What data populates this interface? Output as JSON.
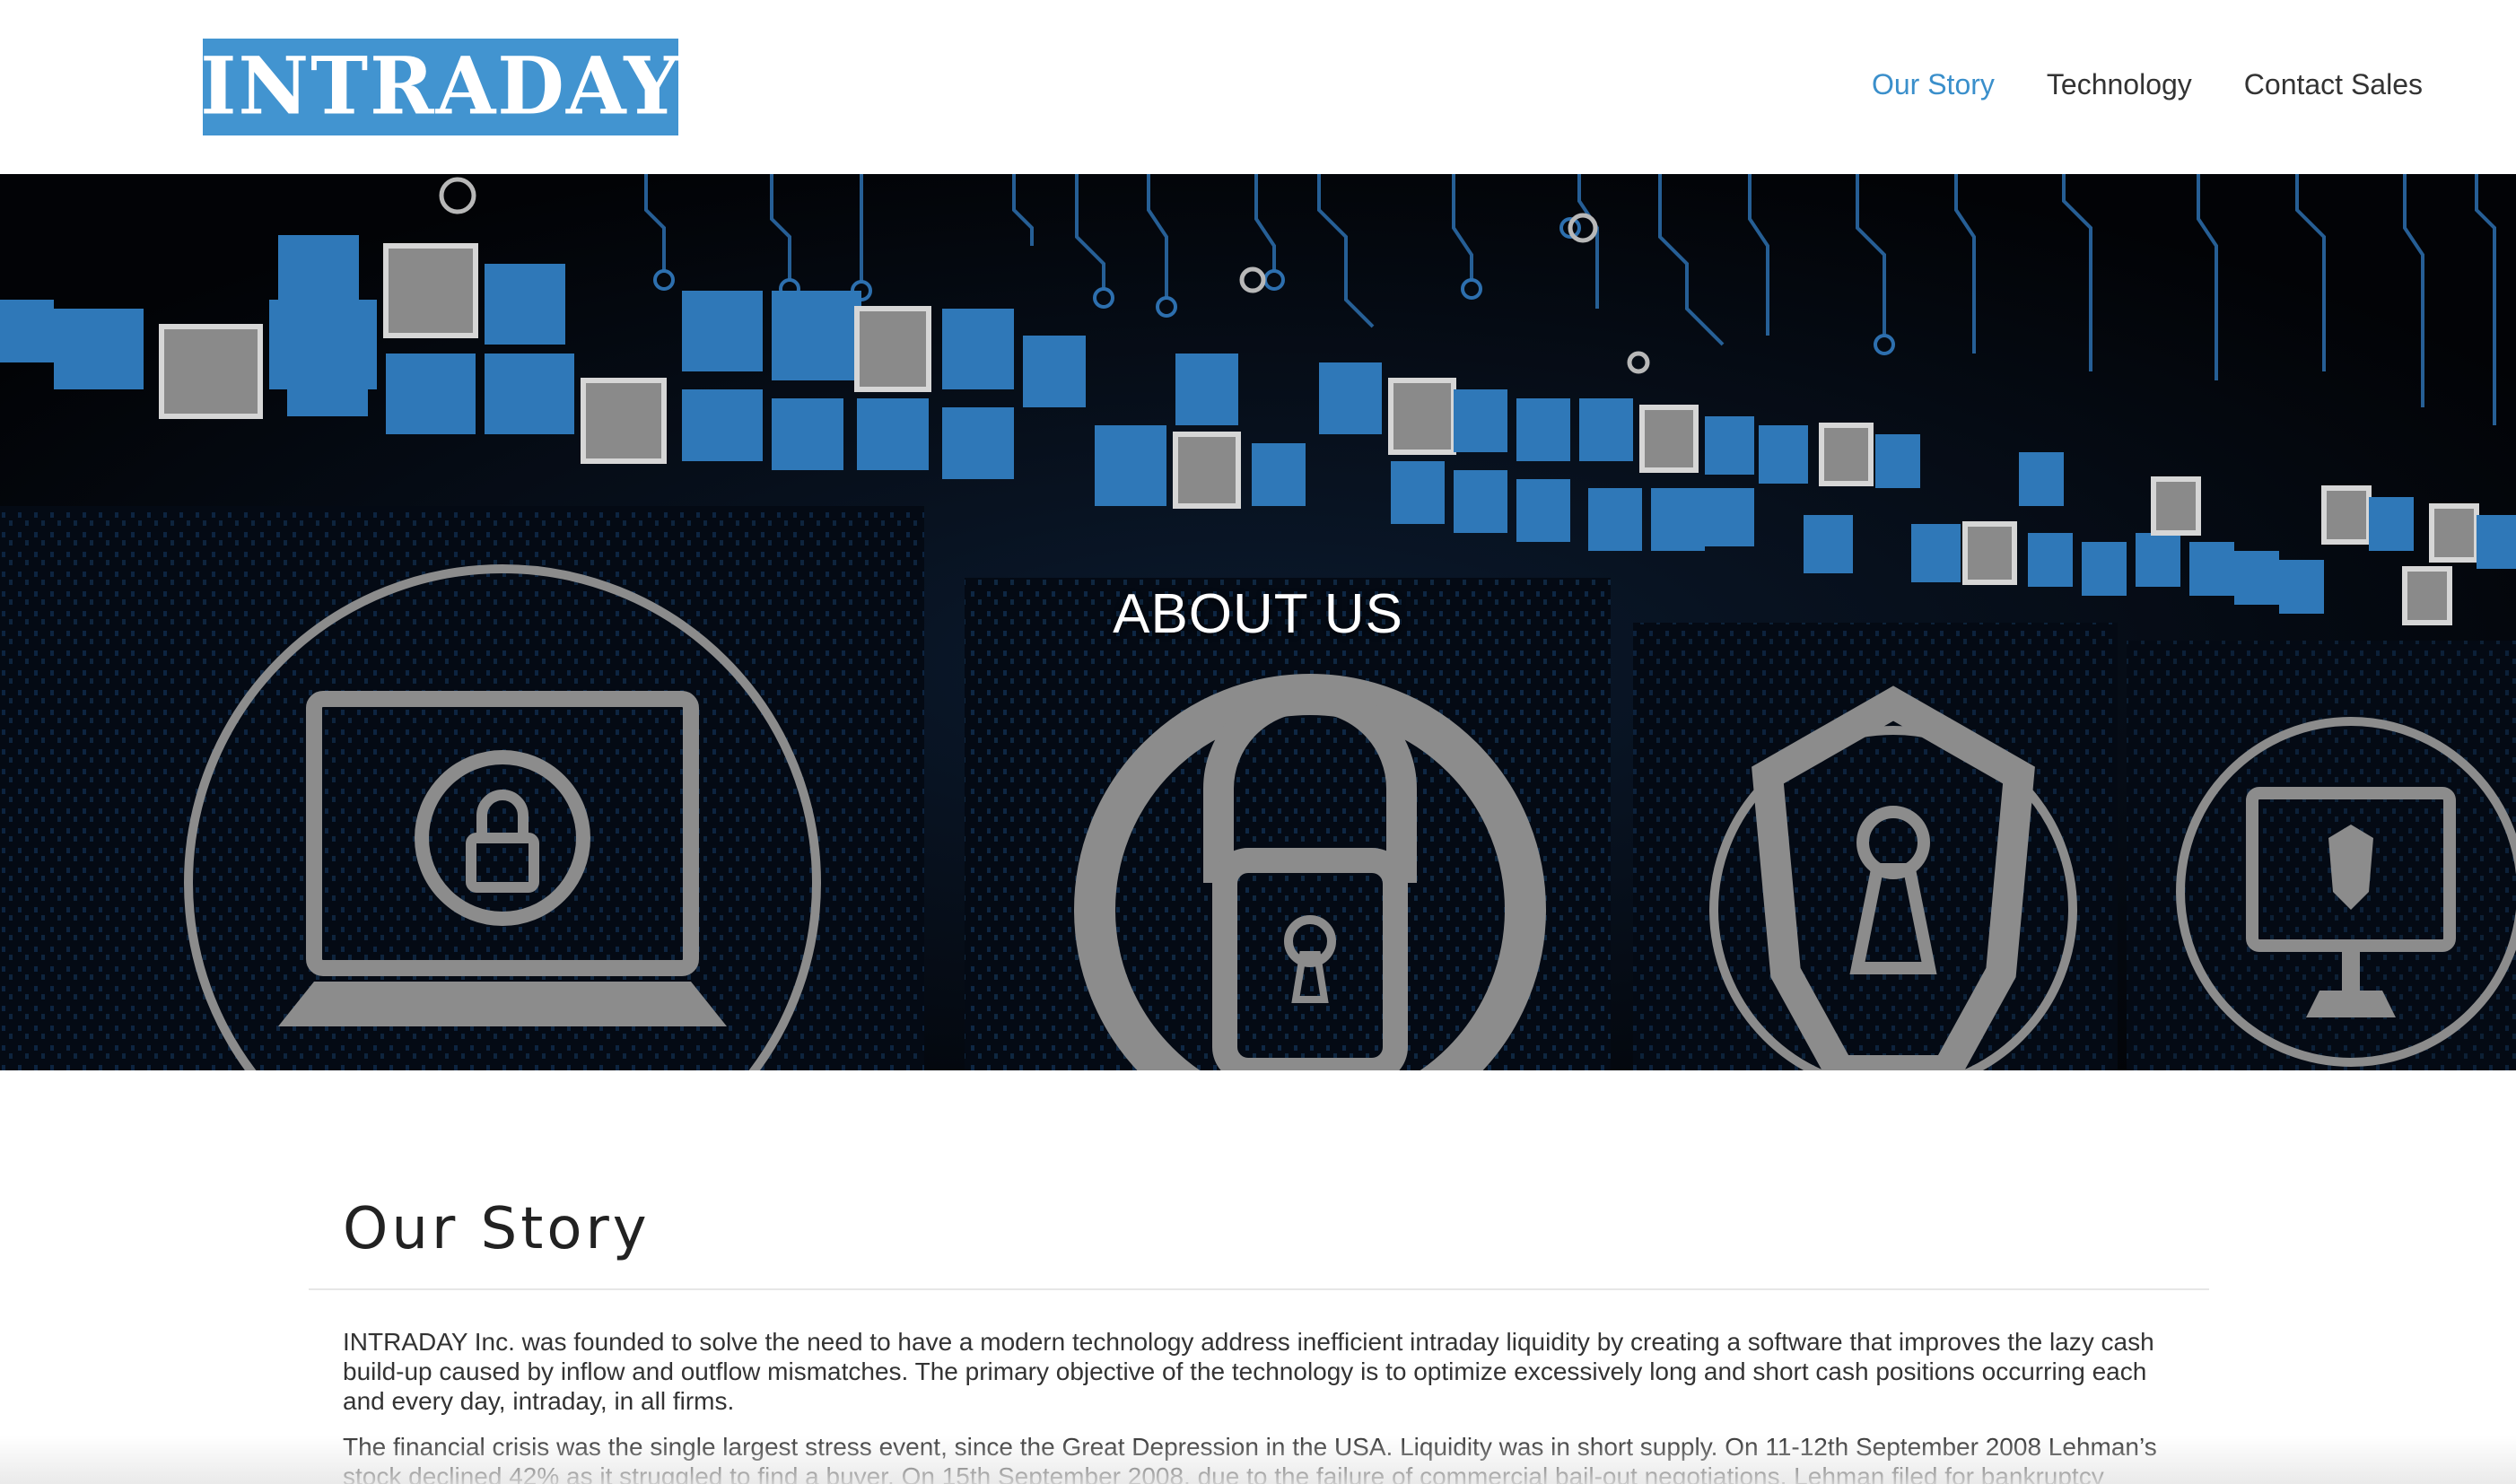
{
  "header": {
    "logo_text": "INTRADAY",
    "nav": [
      {
        "label": "Our Story",
        "active": true
      },
      {
        "label": "Technology",
        "active": false
      },
      {
        "label": "Contact Sales",
        "active": false
      }
    ]
  },
  "hero": {
    "title": "ABOUT US",
    "icons": [
      "laptop-lock-icon",
      "padlock-icon",
      "shield-keyhole-icon",
      "monitor-shield-icon"
    ]
  },
  "story": {
    "title": "Our Story",
    "paragraphs": [
      "INTRADAY Inc. was founded to solve the need to have a modern technology address inefficient intraday liquidity by creating a software that improves the lazy cash build-up caused by inflow and outflow mismatches. The primary objective of the technology is to optimize excessively long and short cash positions occurring each and every day, intraday, in all firms.",
      "The financial crisis was the single largest stress event, since the Great Depression in the USA. Liquidity was in short supply. On 11-12th September 2008 Lehman’s stock declined 42% as it struggled to find a buyer. On 15th September 2008, due to the failure of commercial bail-out negotiations, Lehman filed for bankruptcy"
    ]
  },
  "colors": {
    "brand": "#4294d0",
    "nav_active": "#3a8fcb",
    "hero_bg": "#05070c",
    "tile_blue": "#2f78b8",
    "tile_gray": "#8a8a8a"
  }
}
